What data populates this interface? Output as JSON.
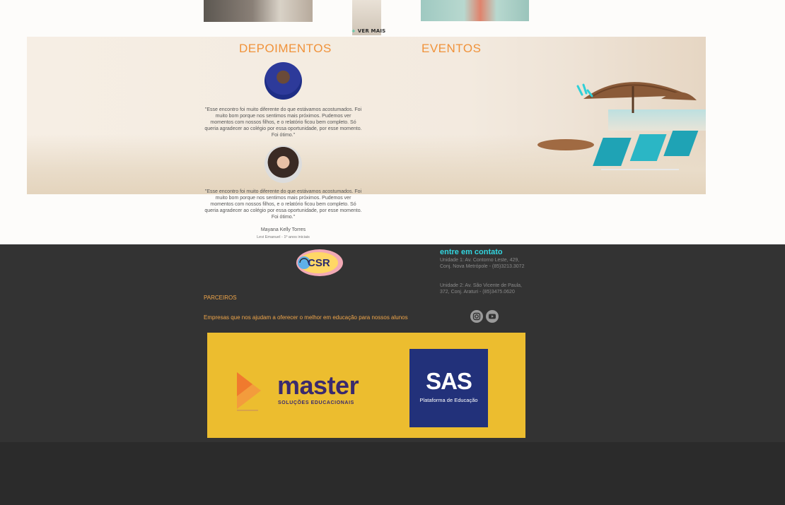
{
  "gallery": {
    "ver_mais_label": "VER MAIS"
  },
  "testimonials": {
    "title": "DEPOIMENTOS",
    "items": [
      {
        "quote": "\"Esse encontro foi muito diferente do que estávamos acostumados. Foi muito bom porque nos sentimos mais próximos. Pudemos ver momentos com nossos filhos, e o relatório ficou bem completo. Só queria agradecer ao colégio por essa oportunidade, por esse momento. Foi ótimo.\""
      },
      {
        "quote": "\"Esse encontro foi muito diferente do que estávamos acostumados. Foi muito bom porque nos sentimos mais próximos. Pudemos ver momentos com nossos filhos, e o relatório ficou bem completo. Só queria agradecer ao colégio por essa oportunidade, por esse momento. Foi ótimo.\"",
        "author": "Mayana Kelly Torres",
        "author_info": "Levi Emanuel - 1º anos iniciais"
      }
    ]
  },
  "events": {
    "title": "EVENTOS"
  },
  "footer": {
    "logo_text": "CSR",
    "parceiros_title": "PARCEIROS",
    "parceiros_desc": "Empresas que nos ajudam a oferecer o melhor em educação para nossos alunos",
    "contact_title": "entre em contato",
    "unit1": "Unidade 1: Av. Contorno Leste, 429, Conj. Nova Metrópole - (85)3213.3072",
    "unit2": "Unidade 2: Av. São Vicente de Paula, 372, Conj. Araturi - (85)3475.0620",
    "social": [
      "instagram-icon",
      "youtube-icon"
    ]
  },
  "partners": {
    "master_name": "master",
    "master_sub": "SOLUÇÕES EDUCACIONAIS",
    "sas_name": "SAS",
    "sas_sub": "Plataforma de Educação"
  },
  "colors": {
    "accent_orange": "#f0923a",
    "contact_cyan": "#32d6e0",
    "footer_bg": "#333333",
    "partners_bg": "#ecbd2f",
    "sas_blue": "#22317a",
    "master_purple": "#3a2a6e"
  }
}
